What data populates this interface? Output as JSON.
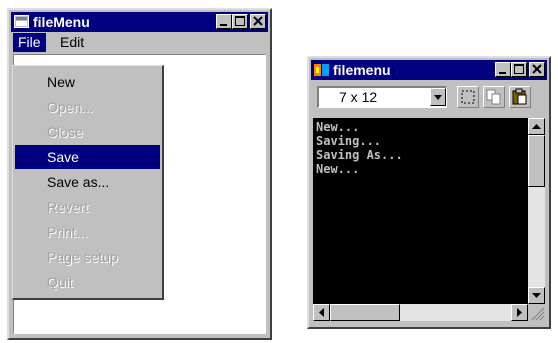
{
  "file_menu_window": {
    "title": "fileMenu",
    "title_icon": "window-icon",
    "controls": [
      "minimize-icon",
      "maximize-icon",
      "close-icon"
    ],
    "menubar": [
      {
        "label": "File",
        "active": true
      },
      {
        "label": "Edit",
        "active": false
      }
    ],
    "file_menu_items": [
      {
        "label": "New",
        "state": "enabled"
      },
      {
        "label": "Open...",
        "state": "disabled"
      },
      {
        "label": "Close",
        "state": "disabled"
      },
      {
        "label": "Save",
        "state": "highlighted"
      },
      {
        "label": "Save as...",
        "state": "enabled"
      },
      {
        "label": "Revert",
        "state": "disabled"
      },
      {
        "label": "Print...",
        "state": "disabled"
      },
      {
        "label": "Page setup",
        "state": "disabled"
      },
      {
        "label": "Quit",
        "state": "disabled"
      }
    ]
  },
  "console_window": {
    "title": "filemenu",
    "title_icon": "ms-dos-icon",
    "controls": [
      "minimize-icon",
      "maximize-icon",
      "close-icon"
    ],
    "font_size_select": "7 x 12",
    "toolbar_icons": [
      "mark-icon",
      "copy-icon",
      "paste-icon"
    ],
    "output_lines": [
      "New...",
      "Saving...",
      "Saving As...",
      "New..."
    ]
  },
  "colors": {
    "titlebar": "#000080",
    "face": "#c0c0c0",
    "highlight": "#000080",
    "disabled_text": "#a0a0a0",
    "console_bg": "#000000",
    "console_text": "#c0c0c0"
  }
}
